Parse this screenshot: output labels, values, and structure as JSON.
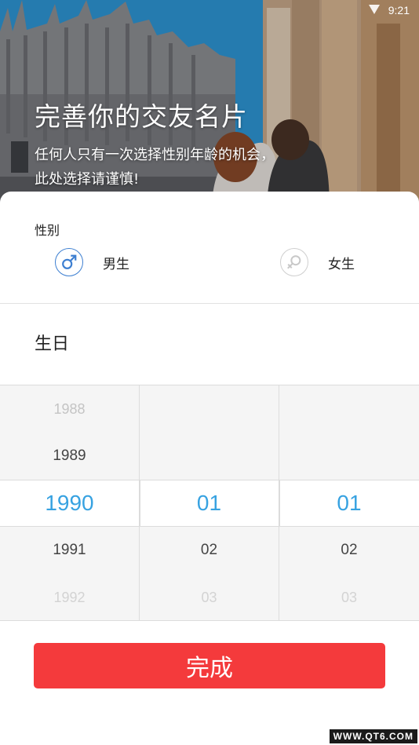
{
  "status_bar": {
    "time": "9:21"
  },
  "hero": {
    "title": "完善你的交友名片",
    "subtitle_line1": "任何人只有一次选择性别年龄的机会，",
    "subtitle_line2": "此处选择请谨慎!"
  },
  "gender": {
    "label": "性别",
    "selected": "male",
    "options": [
      {
        "id": "male",
        "label": "男生",
        "icon": "male-symbol-icon",
        "color": "#3d7fd1"
      },
      {
        "id": "female",
        "label": "女生",
        "icon": "female-symbol-icon",
        "color": "#cfcfcf"
      }
    ]
  },
  "birthday": {
    "label": "生日",
    "year": {
      "items": [
        "1988",
        "1989",
        "1990",
        "1991",
        "1992"
      ],
      "selected": "1990"
    },
    "month": {
      "items": [
        "",
        "",
        "01",
        "02",
        "03"
      ],
      "selected": "01"
    },
    "day": {
      "items": [
        "",
        "",
        "01",
        "02",
        "03"
      ],
      "selected": "01"
    },
    "accent_color": "#37a2e1"
  },
  "done_button": {
    "label": "完成",
    "color": "#f43a3c"
  },
  "watermark": "WWW.QT6.COM"
}
